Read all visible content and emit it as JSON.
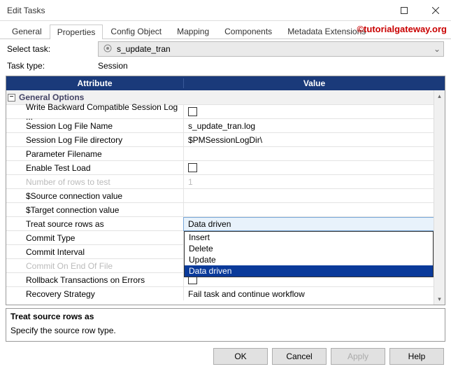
{
  "window": {
    "title": "Edit Tasks"
  },
  "watermark": "©tutorialgateway.org",
  "tabs": [
    {
      "label": "General"
    },
    {
      "label": "Properties"
    },
    {
      "label": "Config Object"
    },
    {
      "label": "Mapping"
    },
    {
      "label": "Components"
    },
    {
      "label": "Metadata Extensions"
    }
  ],
  "active_tab_index": 1,
  "form": {
    "select_task_label": "Select task:",
    "select_task_value": "s_update_tran",
    "task_type_label": "Task type:",
    "task_type_value": "Session"
  },
  "grid": {
    "headers": {
      "attribute": "Attribute",
      "value": "Value"
    },
    "group": {
      "label": "General Options",
      "expanded": true
    },
    "rows": [
      {
        "attr": "Write Backward Compatible Session Log ...",
        "type": "checkbox",
        "checked": false
      },
      {
        "attr": "Session Log File Name",
        "type": "text",
        "value": "s_update_tran.log"
      },
      {
        "attr": "Session Log File directory",
        "type": "text",
        "value": "$PMSessionLogDir\\"
      },
      {
        "attr": "Parameter Filename",
        "type": "text",
        "value": ""
      },
      {
        "attr": "Enable Test Load",
        "type": "checkbox",
        "checked": false
      },
      {
        "attr": "Number of rows to test",
        "type": "text",
        "value": "1",
        "disabled": true
      },
      {
        "attr": "$Source connection value",
        "type": "text",
        "value": ""
      },
      {
        "attr": "$Target connection value",
        "type": "text",
        "value": ""
      },
      {
        "attr": "Treat source rows as",
        "type": "dropdown",
        "value": "Data driven"
      },
      {
        "attr": "Commit Type",
        "type": "text",
        "value": ""
      },
      {
        "attr": "Commit Interval",
        "type": "text",
        "value": ""
      },
      {
        "attr": "Commit On End Of File",
        "type": "text",
        "value": "",
        "disabled": true
      },
      {
        "attr": "Rollback Transactions on Errors",
        "type": "checkbox",
        "checked": false
      },
      {
        "attr": "Recovery Strategy",
        "type": "text",
        "value": "Fail task and continue workflow"
      }
    ],
    "dropdown_options": [
      "Insert",
      "Delete",
      "Update",
      "Data driven"
    ],
    "dropdown_selected": "Data driven"
  },
  "description": {
    "title": "Treat source rows as",
    "text": "Specify the source row type."
  },
  "footer": {
    "ok": "OK",
    "cancel": "Cancel",
    "apply": "Apply",
    "help": "Help"
  }
}
